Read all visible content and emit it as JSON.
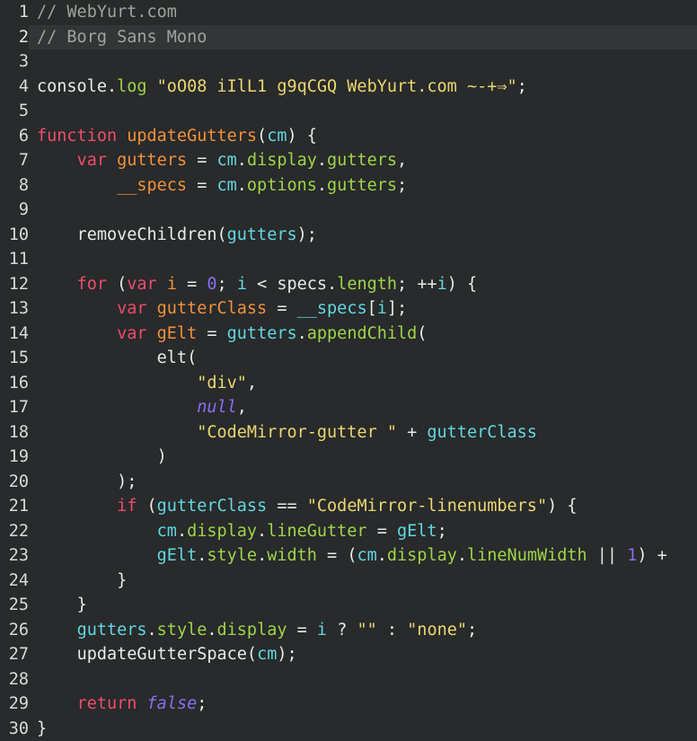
{
  "editor": {
    "theme_name": "dark-monokai-like",
    "font_sample_name": "Borg Sans Mono",
    "colors": {
      "background": "#282a2b",
      "active_line": "#333637",
      "gutter_text": "#d9dbd6",
      "plain": "#e9ebe6",
      "comment": "#a0a39c",
      "keyword": "#ef4c6c",
      "definition": "#f0913b",
      "variable": "#63d7e0",
      "property": "#9fd44a",
      "string": "#ebd770",
      "number": "#8a6ff0",
      "atom": "#8a6ff0"
    },
    "active_line_number": 2,
    "total_lines": 30,
    "lines": [
      {
        "number": "1",
        "tokens": [
          {
            "text": "// WebYurt.com",
            "cls": "t-comment"
          }
        ]
      },
      {
        "number": "2",
        "tokens": [
          {
            "text": "// Borg Sans Mono",
            "cls": "t-comment"
          }
        ]
      },
      {
        "number": "3",
        "tokens": []
      },
      {
        "number": "4",
        "tokens": [
          {
            "text": "console",
            "cls": "t-plain"
          },
          {
            "text": ".",
            "cls": "t-punct"
          },
          {
            "text": "log",
            "cls": "t-prop"
          },
          {
            "text": " ",
            "cls": "t-plain"
          },
          {
            "text": "\"oO08 iIlL1 g9qCGQ WebYurt.com ~-+⇒\"",
            "cls": "t-string"
          },
          {
            "text": ";",
            "cls": "t-punct"
          }
        ]
      },
      {
        "number": "5",
        "tokens": []
      },
      {
        "number": "6",
        "tokens": [
          {
            "text": "function",
            "cls": "t-keyword"
          },
          {
            "text": " ",
            "cls": "t-plain"
          },
          {
            "text": "updateGutters",
            "cls": "t-def"
          },
          {
            "text": "(",
            "cls": "t-paren"
          },
          {
            "text": "cm",
            "cls": "t-var"
          },
          {
            "text": ")",
            "cls": "t-paren"
          },
          {
            "text": " ",
            "cls": "t-plain"
          },
          {
            "text": "{",
            "cls": "t-punct"
          }
        ]
      },
      {
        "number": "7",
        "tokens": [
          {
            "text": "    ",
            "cls": "t-plain"
          },
          {
            "text": "var",
            "cls": "t-keyword"
          },
          {
            "text": " ",
            "cls": "t-plain"
          },
          {
            "text": "gutters",
            "cls": "t-def"
          },
          {
            "text": " ",
            "cls": "t-plain"
          },
          {
            "text": "=",
            "cls": "t-op"
          },
          {
            "text": " ",
            "cls": "t-plain"
          },
          {
            "text": "cm",
            "cls": "t-var"
          },
          {
            "text": ".",
            "cls": "t-punct"
          },
          {
            "text": "display",
            "cls": "t-prop"
          },
          {
            "text": ".",
            "cls": "t-punct"
          },
          {
            "text": "gutters",
            "cls": "t-prop"
          },
          {
            "text": ",",
            "cls": "t-punct"
          }
        ]
      },
      {
        "number": "8",
        "tokens": [
          {
            "text": "        ",
            "cls": "t-plain"
          },
          {
            "text": "__specs",
            "cls": "t-def"
          },
          {
            "text": " ",
            "cls": "t-plain"
          },
          {
            "text": "=",
            "cls": "t-op"
          },
          {
            "text": " ",
            "cls": "t-plain"
          },
          {
            "text": "cm",
            "cls": "t-var"
          },
          {
            "text": ".",
            "cls": "t-punct"
          },
          {
            "text": "options",
            "cls": "t-prop"
          },
          {
            "text": ".",
            "cls": "t-punct"
          },
          {
            "text": "gutters",
            "cls": "t-prop"
          },
          {
            "text": ";",
            "cls": "t-punct"
          }
        ]
      },
      {
        "number": "9",
        "tokens": []
      },
      {
        "number": "10",
        "tokens": [
          {
            "text": "    ",
            "cls": "t-plain"
          },
          {
            "text": "removeChildren",
            "cls": "t-plain"
          },
          {
            "text": "(",
            "cls": "t-paren"
          },
          {
            "text": "gutters",
            "cls": "t-var"
          },
          {
            "text": ")",
            "cls": "t-paren"
          },
          {
            "text": ";",
            "cls": "t-punct"
          }
        ]
      },
      {
        "number": "11",
        "tokens": []
      },
      {
        "number": "12",
        "tokens": [
          {
            "text": "    ",
            "cls": "t-plain"
          },
          {
            "text": "for",
            "cls": "t-keyword"
          },
          {
            "text": " ",
            "cls": "t-plain"
          },
          {
            "text": "(",
            "cls": "t-paren"
          },
          {
            "text": "var",
            "cls": "t-keyword"
          },
          {
            "text": " ",
            "cls": "t-plain"
          },
          {
            "text": "i",
            "cls": "t-def"
          },
          {
            "text": " ",
            "cls": "t-plain"
          },
          {
            "text": "=",
            "cls": "t-op"
          },
          {
            "text": " ",
            "cls": "t-plain"
          },
          {
            "text": "0",
            "cls": "t-number"
          },
          {
            "text": "; ",
            "cls": "t-punct"
          },
          {
            "text": "i",
            "cls": "t-var"
          },
          {
            "text": " ",
            "cls": "t-plain"
          },
          {
            "text": "<",
            "cls": "t-op"
          },
          {
            "text": " ",
            "cls": "t-plain"
          },
          {
            "text": "specs",
            "cls": "t-plain"
          },
          {
            "text": ".",
            "cls": "t-punct"
          },
          {
            "text": "length",
            "cls": "t-prop"
          },
          {
            "text": "; ",
            "cls": "t-punct"
          },
          {
            "text": "++",
            "cls": "t-op"
          },
          {
            "text": "i",
            "cls": "t-var"
          },
          {
            "text": ")",
            "cls": "t-paren"
          },
          {
            "text": " ",
            "cls": "t-plain"
          },
          {
            "text": "{",
            "cls": "t-punct"
          }
        ]
      },
      {
        "number": "13",
        "tokens": [
          {
            "text": "        ",
            "cls": "t-plain"
          },
          {
            "text": "var",
            "cls": "t-keyword"
          },
          {
            "text": " ",
            "cls": "t-plain"
          },
          {
            "text": "gutterClass",
            "cls": "t-def"
          },
          {
            "text": " ",
            "cls": "t-plain"
          },
          {
            "text": "=",
            "cls": "t-op"
          },
          {
            "text": " ",
            "cls": "t-plain"
          },
          {
            "text": "__specs",
            "cls": "t-var"
          },
          {
            "text": "[",
            "cls": "t-paren"
          },
          {
            "text": "i",
            "cls": "t-var"
          },
          {
            "text": "]",
            "cls": "t-paren"
          },
          {
            "text": ";",
            "cls": "t-punct"
          }
        ]
      },
      {
        "number": "14",
        "tokens": [
          {
            "text": "        ",
            "cls": "t-plain"
          },
          {
            "text": "var",
            "cls": "t-keyword"
          },
          {
            "text": " ",
            "cls": "t-plain"
          },
          {
            "text": "gElt",
            "cls": "t-def"
          },
          {
            "text": " ",
            "cls": "t-plain"
          },
          {
            "text": "=",
            "cls": "t-op"
          },
          {
            "text": " ",
            "cls": "t-plain"
          },
          {
            "text": "gutters",
            "cls": "t-var"
          },
          {
            "text": ".",
            "cls": "t-punct"
          },
          {
            "text": "appendChild",
            "cls": "t-prop"
          },
          {
            "text": "(",
            "cls": "t-paren"
          }
        ]
      },
      {
        "number": "15",
        "tokens": [
          {
            "text": "            ",
            "cls": "t-plain"
          },
          {
            "text": "elt",
            "cls": "t-plain"
          },
          {
            "text": "(",
            "cls": "t-paren"
          }
        ]
      },
      {
        "number": "16",
        "tokens": [
          {
            "text": "                ",
            "cls": "t-plain"
          },
          {
            "text": "\"div\"",
            "cls": "t-string"
          },
          {
            "text": ",",
            "cls": "t-punct"
          }
        ]
      },
      {
        "number": "17",
        "tokens": [
          {
            "text": "                ",
            "cls": "t-plain"
          },
          {
            "text": "null",
            "cls": "t-atom"
          },
          {
            "text": ",",
            "cls": "t-punct"
          }
        ]
      },
      {
        "number": "18",
        "tokens": [
          {
            "text": "                ",
            "cls": "t-plain"
          },
          {
            "text": "\"CodeMirror-gutter \"",
            "cls": "t-string"
          },
          {
            "text": " ",
            "cls": "t-plain"
          },
          {
            "text": "+",
            "cls": "t-op"
          },
          {
            "text": " ",
            "cls": "t-plain"
          },
          {
            "text": "gutterClass",
            "cls": "t-var"
          }
        ]
      },
      {
        "number": "19",
        "tokens": [
          {
            "text": "            ",
            "cls": "t-plain"
          },
          {
            "text": ")",
            "cls": "t-paren"
          }
        ]
      },
      {
        "number": "20",
        "tokens": [
          {
            "text": "        ",
            "cls": "t-plain"
          },
          {
            "text": ")",
            "cls": "t-paren"
          },
          {
            "text": ";",
            "cls": "t-punct"
          }
        ]
      },
      {
        "number": "21",
        "tokens": [
          {
            "text": "        ",
            "cls": "t-plain"
          },
          {
            "text": "if",
            "cls": "t-keyword"
          },
          {
            "text": " ",
            "cls": "t-plain"
          },
          {
            "text": "(",
            "cls": "t-paren"
          },
          {
            "text": "gutterClass",
            "cls": "t-var"
          },
          {
            "text": " ",
            "cls": "t-plain"
          },
          {
            "text": "==",
            "cls": "t-op"
          },
          {
            "text": " ",
            "cls": "t-plain"
          },
          {
            "text": "\"CodeMirror-linenumbers\"",
            "cls": "t-string"
          },
          {
            "text": ")",
            "cls": "t-paren"
          },
          {
            "text": " ",
            "cls": "t-plain"
          },
          {
            "text": "{",
            "cls": "t-punct"
          }
        ]
      },
      {
        "number": "22",
        "tokens": [
          {
            "text": "            ",
            "cls": "t-plain"
          },
          {
            "text": "cm",
            "cls": "t-var"
          },
          {
            "text": ".",
            "cls": "t-punct"
          },
          {
            "text": "display",
            "cls": "t-prop"
          },
          {
            "text": ".",
            "cls": "t-punct"
          },
          {
            "text": "lineGutter",
            "cls": "t-prop"
          },
          {
            "text": " ",
            "cls": "t-plain"
          },
          {
            "text": "=",
            "cls": "t-op"
          },
          {
            "text": " ",
            "cls": "t-plain"
          },
          {
            "text": "gElt",
            "cls": "t-var"
          },
          {
            "text": ";",
            "cls": "t-punct"
          }
        ]
      },
      {
        "number": "23",
        "tokens": [
          {
            "text": "            ",
            "cls": "t-plain"
          },
          {
            "text": "gElt",
            "cls": "t-var"
          },
          {
            "text": ".",
            "cls": "t-punct"
          },
          {
            "text": "style",
            "cls": "t-prop"
          },
          {
            "text": ".",
            "cls": "t-punct"
          },
          {
            "text": "width",
            "cls": "t-prop"
          },
          {
            "text": " ",
            "cls": "t-plain"
          },
          {
            "text": "=",
            "cls": "t-op"
          },
          {
            "text": " ",
            "cls": "t-plain"
          },
          {
            "text": "(",
            "cls": "t-paren"
          },
          {
            "text": "cm",
            "cls": "t-var"
          },
          {
            "text": ".",
            "cls": "t-punct"
          },
          {
            "text": "display",
            "cls": "t-prop"
          },
          {
            "text": ".",
            "cls": "t-punct"
          },
          {
            "text": "lineNumWidth",
            "cls": "t-prop"
          },
          {
            "text": " ",
            "cls": "t-plain"
          },
          {
            "text": "||",
            "cls": "t-op"
          },
          {
            "text": " ",
            "cls": "t-plain"
          },
          {
            "text": "1",
            "cls": "t-number"
          },
          {
            "text": ")",
            "cls": "t-paren"
          },
          {
            "text": " ",
            "cls": "t-plain"
          },
          {
            "text": "+",
            "cls": "t-op"
          }
        ]
      },
      {
        "number": "24",
        "tokens": [
          {
            "text": "        ",
            "cls": "t-plain"
          },
          {
            "text": "}",
            "cls": "t-punct"
          }
        ]
      },
      {
        "number": "25",
        "tokens": [
          {
            "text": "    ",
            "cls": "t-plain"
          },
          {
            "text": "}",
            "cls": "t-punct"
          }
        ]
      },
      {
        "number": "26",
        "tokens": [
          {
            "text": "    ",
            "cls": "t-plain"
          },
          {
            "text": "gutters",
            "cls": "t-var"
          },
          {
            "text": ".",
            "cls": "t-punct"
          },
          {
            "text": "style",
            "cls": "t-prop"
          },
          {
            "text": ".",
            "cls": "t-punct"
          },
          {
            "text": "display",
            "cls": "t-prop"
          },
          {
            "text": " ",
            "cls": "t-plain"
          },
          {
            "text": "=",
            "cls": "t-op"
          },
          {
            "text": " ",
            "cls": "t-plain"
          },
          {
            "text": "i",
            "cls": "t-var"
          },
          {
            "text": " ",
            "cls": "t-plain"
          },
          {
            "text": "?",
            "cls": "t-op"
          },
          {
            "text": " ",
            "cls": "t-plain"
          },
          {
            "text": "\"\"",
            "cls": "t-string"
          },
          {
            "text": " ",
            "cls": "t-plain"
          },
          {
            "text": ":",
            "cls": "t-op"
          },
          {
            "text": " ",
            "cls": "t-plain"
          },
          {
            "text": "\"none\"",
            "cls": "t-string"
          },
          {
            "text": ";",
            "cls": "t-punct"
          }
        ]
      },
      {
        "number": "27",
        "tokens": [
          {
            "text": "    ",
            "cls": "t-plain"
          },
          {
            "text": "updateGutterSpace",
            "cls": "t-plain"
          },
          {
            "text": "(",
            "cls": "t-paren"
          },
          {
            "text": "cm",
            "cls": "t-var"
          },
          {
            "text": ")",
            "cls": "t-paren"
          },
          {
            "text": ";",
            "cls": "t-punct"
          }
        ]
      },
      {
        "number": "28",
        "tokens": []
      },
      {
        "number": "29",
        "tokens": [
          {
            "text": "    ",
            "cls": "t-plain"
          },
          {
            "text": "return",
            "cls": "t-keyword"
          },
          {
            "text": " ",
            "cls": "t-plain"
          },
          {
            "text": "false",
            "cls": "t-atom"
          },
          {
            "text": ";",
            "cls": "t-punct"
          }
        ]
      },
      {
        "number": "30",
        "tokens": [
          {
            "text": "}",
            "cls": "t-punct"
          }
        ]
      }
    ]
  }
}
